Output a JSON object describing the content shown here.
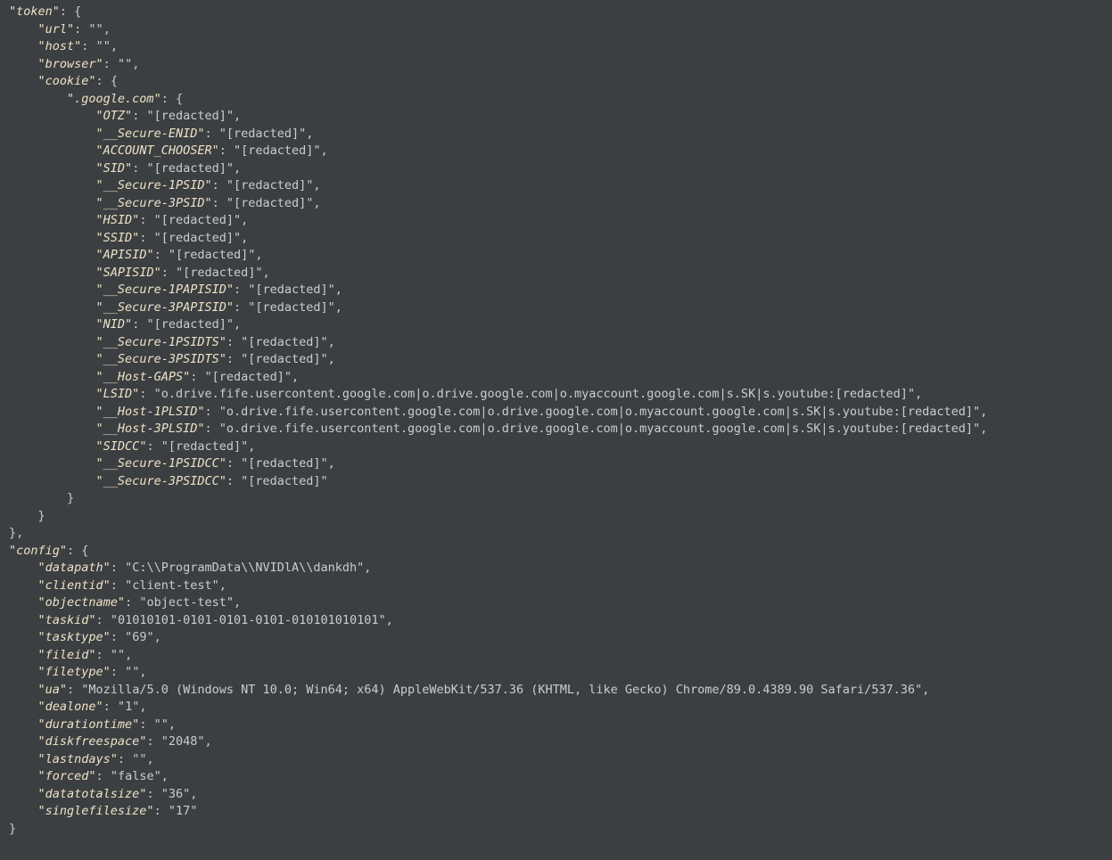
{
  "json_root": {
    "token": {
      "url": "",
      "host": "",
      "browser": "",
      "cookie": {
        ".google.com": {
          "OTZ": "[redacted]",
          "__Secure-ENID": "[redacted]",
          "ACCOUNT_CHOOSER": "[redacted]",
          "SID": "[redacted]",
          "__Secure-1PSID": "[redacted]",
          "__Secure-3PSID": "[redacted]",
          "HSID": "[redacted]",
          "SSID": "[redacted]",
          "APISID": "[redacted]",
          "SAPISID": "[redacted]",
          "__Secure-1PAPISID": "[redacted]",
          "__Secure-3PAPISID": "[redacted]",
          "NID": "[redacted]",
          "__Secure-1PSIDTS": "[redacted]",
          "__Secure-3PSIDTS": "[redacted]",
          "__Host-GAPS": "[redacted]",
          "LSID": "o.drive.fife.usercontent.google.com|o.drive.google.com|o.myaccount.google.com|s.SK|s.youtube:[redacted]",
          "__Host-1PLSID": "o.drive.fife.usercontent.google.com|o.drive.google.com|o.myaccount.google.com|s.SK|s.youtube:[redacted]",
          "__Host-3PLSID": "o.drive.fife.usercontent.google.com|o.drive.google.com|o.myaccount.google.com|s.SK|s.youtube:[redacted]",
          "SIDCC": "[redacted]",
          "__Secure-1PSIDCC": "[redacted]",
          "__Secure-3PSIDCC": "[redacted]"
        }
      }
    },
    "config": {
      "datapath": "C:\\\\ProgramData\\\\NVIDlA\\\\dankdh",
      "clientid": "client-test",
      "objectname": "object-test",
      "taskid": "01010101-0101-0101-0101-010101010101",
      "tasktype": "69",
      "fileid": "",
      "filetype": "",
      "ua": "Mozilla/5.0 (Windows NT 10.0; Win64; x64) AppleWebKit/537.36 (KHTML, like Gecko) Chrome/89.0.4389.90 Safari/537.36",
      "dealone": "1",
      "durationtime": "",
      "diskfreespace": "2048",
      "lastndays": "",
      "forced": "false",
      "datatotalsize": "36",
      "singlefilesize": "17"
    }
  }
}
